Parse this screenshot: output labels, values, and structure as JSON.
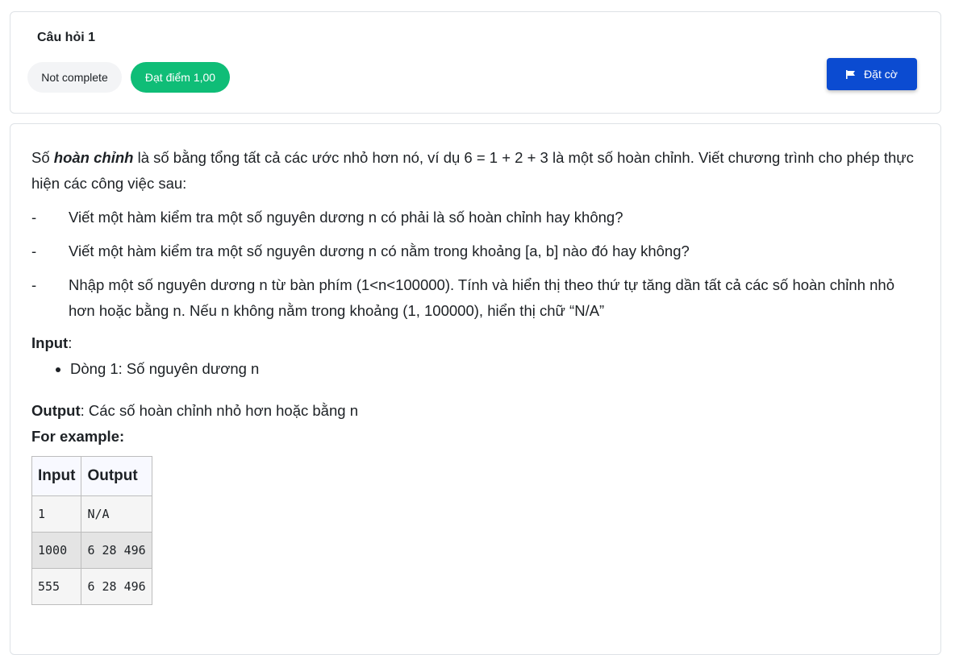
{
  "question": {
    "title": "Câu hỏi 1",
    "status": "Not complete",
    "grade": "Đạt điểm 1,00",
    "flag_label": "Đặt cờ",
    "flag_icon": "flag-icon"
  },
  "content": {
    "intro_prefix": "Số ",
    "intro_emphasis": "hoàn chỉnh",
    "intro_rest": " là số bằng tổng tất cả các ước nhỏ hơn nó, ví dụ 6 = 1 + 2 + 3 là một số hoàn chỉnh. Viết chương trình cho phép thực hiện các công việc sau:",
    "tasks": [
      "Viết một hàm kiểm tra một số nguyên dương n có phải là số hoàn chỉnh hay không?",
      "Viết một hàm kiểm tra một số nguyên dương n có nằm trong khoảng [a, b] nào đó hay không?",
      "Nhập một số nguyên dương n từ bàn phím (1<n<100000). Tính và hiển thị theo thứ tự tăng dần tất cả các số hoàn chỉnh nhỏ hơn hoặc bằng n. Nếu n không nằm trong khoảng (1, 100000), hiển thị chữ “N/A”"
    ],
    "task_marker": "-",
    "input_label": "Input",
    "input_items": [
      "Dòng 1: Số nguyên dương n"
    ],
    "output_label": "Output",
    "output_text": ": Các số hoàn chỉnh nhỏ hơn hoặc bằng n",
    "example_label": "For example:",
    "table": {
      "headers": [
        "Input",
        "Output"
      ],
      "rows": [
        [
          "1",
          "N/A"
        ],
        [
          "1000",
          "6 28 496"
        ],
        [
          "555",
          "6 28 496"
        ]
      ]
    }
  }
}
